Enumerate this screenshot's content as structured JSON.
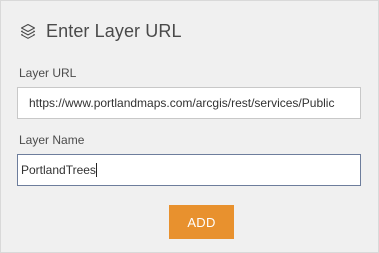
{
  "header": {
    "icon": "layers-icon",
    "title": "Enter Layer URL"
  },
  "form": {
    "url_label": "Layer URL",
    "url_value": "https://www.portlandmaps.com/arcgis/rest/services/Public",
    "name_label": "Layer Name",
    "name_value": "PortlandTrees"
  },
  "actions": {
    "add_label": "ADD"
  },
  "colors": {
    "background": "#f0f0f0",
    "accent": "#e8912e",
    "focus_border": "#6d7d9c"
  }
}
